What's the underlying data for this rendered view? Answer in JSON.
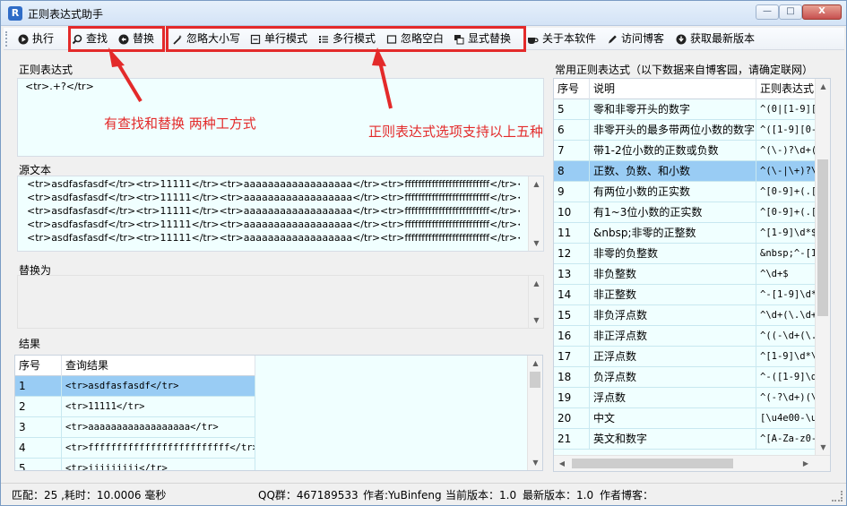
{
  "window": {
    "title": "正则表达式助手",
    "icon_glyph": "R",
    "controls": {
      "minimize": "—",
      "maximize": "□",
      "close": "X"
    }
  },
  "toolbar": {
    "execute": "执行",
    "find": "查找",
    "replace": "替换",
    "ignore_case": "忽略大小写",
    "single_line": "单行模式",
    "multi_line": "多行模式",
    "ignore_whitespace": "忽略空白",
    "show_replace": "显式替换",
    "about": "关于本软件",
    "visit_blog": "访问博客",
    "get_latest": "获取最新版本"
  },
  "regex": {
    "label": "正则表达式",
    "value": "<tr>.+?</tr>"
  },
  "source": {
    "label": "源文本",
    "lines": [
      "<tr>asdfasfasdf</tr><tr>11111</tr><tr>aaaaaaaaaaaaaaaaaa</tr><tr>fffffffffffffffffffffffff</tr><tr>jjjjjjjjj</tr>",
      "<tr>asdfasfasdf</tr><tr>11111</tr><tr>aaaaaaaaaaaaaaaaaa</tr><tr>fffffffffffffffffffffffff</tr><tr>jjjjjjjjj</tr>",
      "<tr>asdfasfasdf</tr><tr>11111</tr><tr>aaaaaaaaaaaaaaaaaa</tr><tr>fffffffffffffffffffffffff</tr><tr>jjjjjjjjj</tr>",
      "<tr>asdfasfasdf</tr><tr>11111</tr><tr>aaaaaaaaaaaaaaaaaa</tr><tr>fffffffffffffffffffffffff</tr><tr>jjjjjjjjj</tr>",
      "<tr>asdfasfasdf</tr><tr>11111</tr><tr>aaaaaaaaaaaaaaaaaa</tr><tr>fffffffffffffffffffffffff</tr><tr>jjjjjjjjj</tr>"
    ]
  },
  "replace_with": {
    "label": "替换为",
    "value": ""
  },
  "results": {
    "label": "结果",
    "columns": [
      "序号",
      "查询结果"
    ],
    "rows": [
      [
        "1",
        "<tr>asdfasfasdf</tr>"
      ],
      [
        "2",
        "<tr>11111</tr>"
      ],
      [
        "3",
        "<tr>aaaaaaaaaaaaaaaaaa</tr>"
      ],
      [
        "4",
        "<tr>fffffffffffffffffffffffff</tr>"
      ],
      [
        "5",
        "<tr>jjjjjjjjj</tr>"
      ]
    ]
  },
  "common": {
    "label": "常用正则表达式（以下数据来自博客园，请确定联网）",
    "columns": [
      "序号",
      "说明",
      "正则表达式"
    ],
    "rows": [
      [
        "5",
        "零和非零开头的数字",
        "^(0|[1-9][0"
      ],
      [
        "6",
        "非零开头的最多带两位小数的数字",
        "^([1-9][0-9"
      ],
      [
        "7",
        "带1-2位小数的正数或负数",
        "^(\\-)?\\d+("
      ],
      [
        "8",
        "正数、负数、和小数",
        "^(\\-|\\+)?\\c"
      ],
      [
        "9",
        "有两位小数的正实数",
        "^[0-9]+(.[0"
      ],
      [
        "10",
        "有1~3位小数的正实数",
        "^[0-9]+(.[0"
      ],
      [
        "11",
        "&nbsp;非零的正整数",
        "^[1-9]\\d*$"
      ],
      [
        "12",
        "非零的负整数",
        "&nbsp;^-[1-"
      ],
      [
        "13",
        "非负整数",
        "^\\d+$"
      ],
      [
        "14",
        "非正整数",
        "^-[1-9]\\d*"
      ],
      [
        "15",
        "非负浮点数",
        "^\\d+(\\.\\d+)"
      ],
      [
        "16",
        "非正浮点数",
        "^((-\\d+(\\.\\"
      ],
      [
        "17",
        "正浮点数",
        "^[1-9]\\d*\\."
      ],
      [
        "18",
        "负浮点数",
        "^-([1-9]\\d*"
      ],
      [
        "19",
        "浮点数",
        "^(-?\\d+)(\\."
      ],
      [
        "20",
        "中文",
        "[\\u4e00-\\u9"
      ],
      [
        "21",
        "英文和数字",
        "^[A-Za-z0-9"
      ]
    ],
    "selected_index": 3
  },
  "annotations": {
    "find_replace_note": "有查找和替换 两种工方式",
    "options_note": "正则表达式选项支持以上五种"
  },
  "status": {
    "match_info": "匹配：25 ,耗时：10.0006 毫秒",
    "qq_group": "QQ群：467189533",
    "author": "作者:YuBinfeng",
    "current_version": "当前版本：1.0",
    "latest_version": "最新版本：1.0",
    "author_blog": "作者博客："
  },
  "colors": {
    "annotation_red": "#e32a2a",
    "selection_blue": "#99ccf4",
    "editor_bg": "#f0ffff"
  }
}
